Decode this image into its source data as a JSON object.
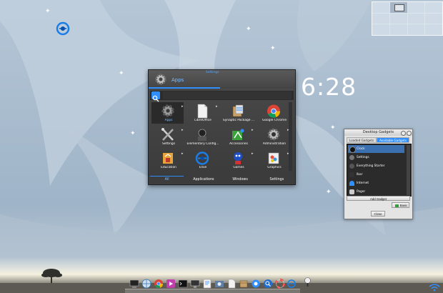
{
  "clock": {
    "time": "6:28"
  },
  "apps_menu": {
    "settings_link": "Settings",
    "title": "Apps",
    "search_placeholder": "",
    "apps": [
      {
        "label": "Apps",
        "icon": "gear-icon",
        "selected": true,
        "has_submenu": true
      },
      {
        "label": "LibreOffice",
        "icon": "document-icon",
        "selected": false,
        "has_submenu": true
      },
      {
        "label": "Synaptic Package ...",
        "icon": "package-icon",
        "selected": false,
        "has_submenu": false
      },
      {
        "label": "Google Chrome",
        "icon": "chrome-icon",
        "selected": false,
        "has_submenu": false
      },
      {
        "label": "Settings",
        "icon": "tools-icon",
        "selected": false,
        "has_submenu": true
      },
      {
        "label": "Elementary Config...",
        "icon": "config-icon",
        "selected": false,
        "has_submenu": false
      },
      {
        "label": "Accessories",
        "icon": "accessories-icon",
        "selected": false,
        "has_submenu": true
      },
      {
        "label": "Administration",
        "icon": "admin-gear-icon",
        "selected": false,
        "has_submenu": true
      },
      {
        "label": "Education",
        "icon": "education-icon",
        "selected": false,
        "has_submenu": true
      },
      {
        "label": "Elive",
        "icon": "elive-icon",
        "selected": false,
        "has_submenu": false
      },
      {
        "label": "Games",
        "icon": "games-icon",
        "selected": false,
        "has_submenu": true
      },
      {
        "label": "Graphics",
        "icon": "graphics-icon",
        "selected": false,
        "has_submenu": true
      }
    ],
    "tabs": [
      {
        "label": "All",
        "active": true
      },
      {
        "label": "Applications",
        "active": false
      },
      {
        "label": "Windows",
        "active": false
      },
      {
        "label": "Settings",
        "active": false
      }
    ]
  },
  "gadgets": {
    "title": "Desktop Gadgets",
    "tabs": [
      {
        "label": "Loaded Gadgets",
        "active": false
      },
      {
        "label": "Available Gadgets",
        "active": true
      }
    ],
    "items": [
      {
        "label": "Clock",
        "icon": "clock-icon",
        "selected": true
      },
      {
        "label": "Settings",
        "icon": "settings-icon",
        "selected": false
      },
      {
        "label": "Everything Starter",
        "icon": "starter-icon",
        "selected": false
      },
      {
        "label": "Ibar",
        "icon": "ibar-icon",
        "selected": false
      },
      {
        "label": "Internet",
        "icon": "internet-icon",
        "selected": false
      },
      {
        "label": "Pager",
        "icon": "pager-icon",
        "selected": false
      }
    ],
    "add_label": "Add Gadget",
    "basic_label": "Basic",
    "close_label": "Close"
  },
  "dock": {
    "items": [
      "computer-icon",
      "network-icon",
      "chrome-icon",
      "media-icon",
      "terminal-icon",
      "monitor-icon",
      "editor-icon",
      "screenshot-icon",
      "document-icon",
      "package-icon",
      "elive-icon",
      "search-icon",
      "lifebuoy-icon",
      "elive-icon"
    ]
  },
  "colors": {
    "accent": "#2f8fff",
    "menu_bg": "#3f3f3f",
    "wallpaper": "#a9bccf"
  }
}
